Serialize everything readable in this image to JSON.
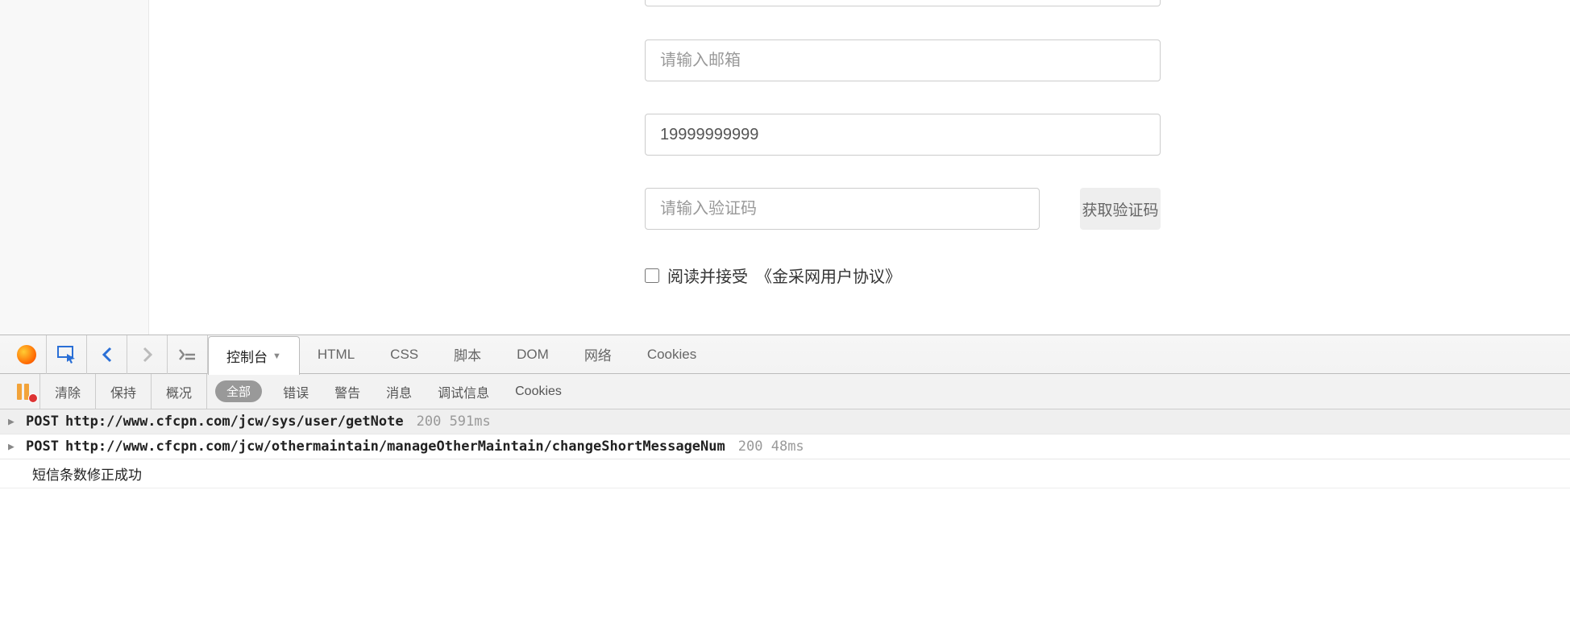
{
  "form": {
    "email_placeholder": "请输入邮箱",
    "phone_value": "19999999999",
    "captcha_placeholder": "请输入验证码",
    "captcha_btn": "获取验证码",
    "agree_prefix": "阅读并接受",
    "agree_link": "《金采网用户协议》"
  },
  "devtools": {
    "tabs": {
      "console": "控制台",
      "html": "HTML",
      "css": "CSS",
      "script": "脚本",
      "dom": "DOM",
      "network": "网络",
      "cookies": "Cookies"
    },
    "subbar": {
      "clear": "清除",
      "keep": "保持",
      "profile": "概况",
      "all": "全部",
      "error": "错误",
      "warn": "警告",
      "info": "消息",
      "debug": "调试信息",
      "cookies": "Cookies"
    },
    "logs": [
      {
        "method": "POST",
        "url": "http://www.cfcpn.com/jcw/sys/user/getNote",
        "status": "200",
        "time": "591ms"
      },
      {
        "method": "POST",
        "url": "http://www.cfcpn.com/jcw/othermaintain/manageOtherMaintain/changeShortMessageNum",
        "status": "200",
        "time": "48ms"
      }
    ],
    "message": "短信条数修正成功"
  }
}
